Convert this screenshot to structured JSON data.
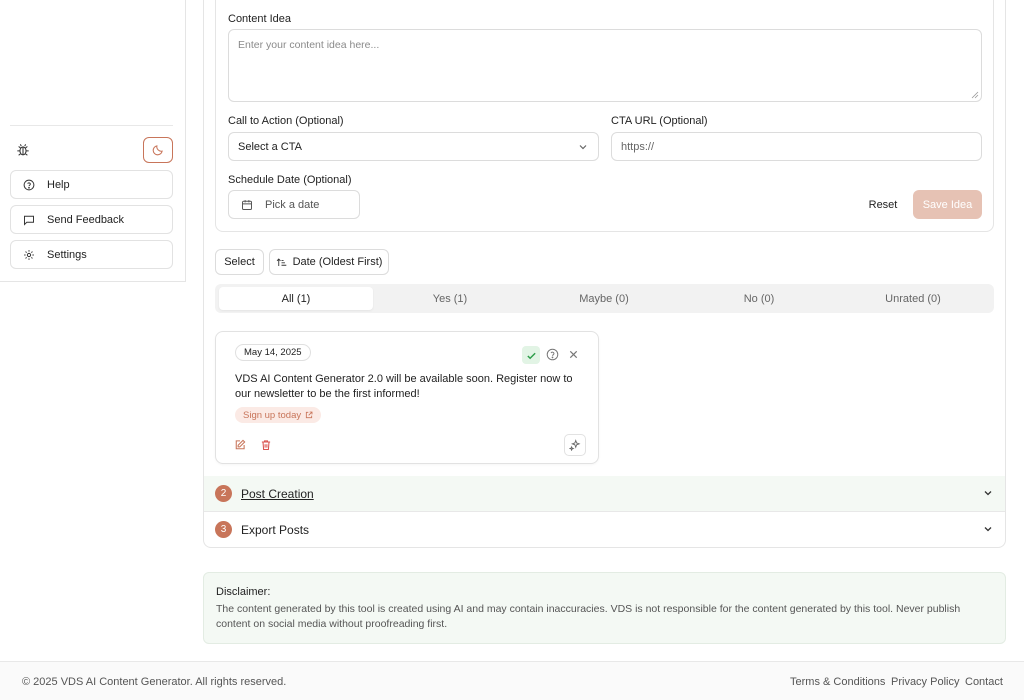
{
  "sidebar": {
    "help_label": "Help",
    "feedback_label": "Send Feedback",
    "settings_label": "Settings"
  },
  "form": {
    "content_idea_label": "Content Idea",
    "content_idea_placeholder": "Enter your content idea here...",
    "cta_label": "Call to Action (Optional)",
    "cta_value": "Select a CTA",
    "cta_url_label": "CTA URL (Optional)",
    "cta_url_placeholder": "https://",
    "schedule_label": "Schedule Date (Optional)",
    "date_placeholder": "Pick a date",
    "reset_label": "Reset",
    "save_label": "Save Idea"
  },
  "toolbar": {
    "select_label": "Select",
    "sort_label": "Date (Oldest First)"
  },
  "tabs": [
    {
      "label": "All (1)",
      "active": true
    },
    {
      "label": "Yes (1)",
      "active": false
    },
    {
      "label": "Maybe (0)",
      "active": false
    },
    {
      "label": "No (0)",
      "active": false
    },
    {
      "label": "Unrated (0)",
      "active": false
    }
  ],
  "idea": {
    "date": "May 14, 2025",
    "text": "VDS AI Content Generator 2.0 will be available soon. Register now to our newsletter to be the first informed!",
    "cta": "Sign up today"
  },
  "accordion": [
    {
      "number": "2",
      "title": "Post Creation"
    },
    {
      "number": "3",
      "title": "Export Posts"
    }
  ],
  "disclaimer": {
    "title": "Disclaimer:",
    "text": "The content generated by this tool is created using AI and may contain inaccuracies. VDS is not responsible for the content generated by this tool. Never publish content on social media without proofreading first."
  },
  "footer": {
    "copyright": "© 2025 VDS AI Content Generator. All rights reserved.",
    "links": [
      "Terms & Conditions",
      "Privacy Policy",
      "Contact"
    ]
  },
  "colors": {
    "accent": "#c8755a",
    "save_disabled": "#e6c2b4",
    "success_bg": "#e2f4e5",
    "danger": "#d9534f"
  }
}
